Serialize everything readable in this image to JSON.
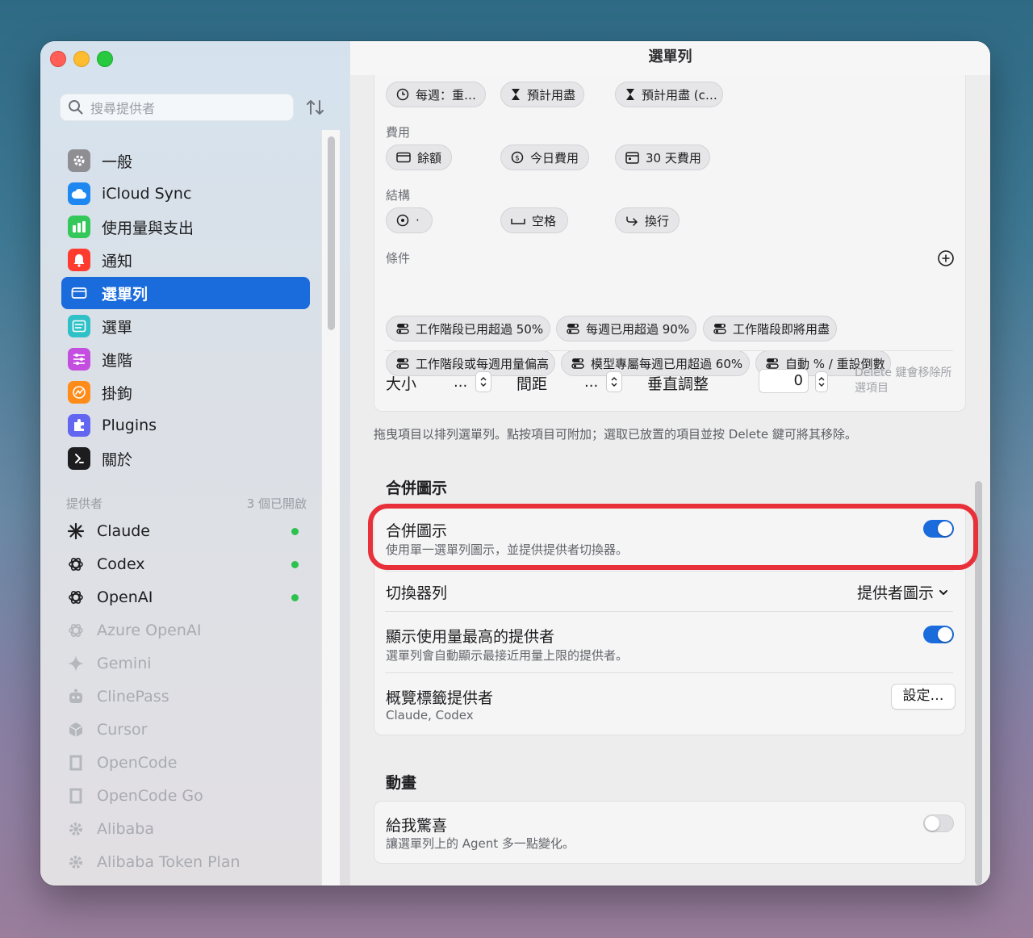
{
  "window": {
    "title": "選單列"
  },
  "sidebar": {
    "search_placeholder": "搜尋提供者",
    "items": [
      {
        "label": "一般",
        "icon": "gear-icon",
        "color": "#8e8e93"
      },
      {
        "label": "iCloud Sync",
        "icon": "cloud-icon",
        "color": "#1e88f0"
      },
      {
        "label": "使用量與支出",
        "icon": "bar-chart-icon",
        "color": "#34c759"
      },
      {
        "label": "通知",
        "icon": "bell-icon",
        "color": "#ff3b30"
      },
      {
        "label": "選單列",
        "icon": "menubar-icon",
        "color": "#1a6bdc"
      },
      {
        "label": "選單",
        "icon": "menu-icon",
        "color": "#30c0c8"
      },
      {
        "label": "進階",
        "icon": "sliders-icon",
        "color": "#c44ee0"
      },
      {
        "label": "掛鉤",
        "icon": "hook-icon",
        "color": "#ff8c1a"
      },
      {
        "label": "Plugins",
        "icon": "plugin-icon",
        "color": "#6366f1"
      },
      {
        "label": "關於",
        "icon": "terminal-icon",
        "color": "#1d1d1f"
      }
    ],
    "providers_header": "提供者",
    "providers_count": "3 個已開啟",
    "providers": [
      {
        "label": "Claude",
        "icon": "claude-icon",
        "enabled": true
      },
      {
        "label": "Codex",
        "icon": "openai-icon",
        "enabled": true
      },
      {
        "label": "OpenAI",
        "icon": "openai-icon",
        "enabled": true
      },
      {
        "label": "Azure OpenAI",
        "icon": "openai-icon",
        "enabled": false
      },
      {
        "label": "Gemini",
        "icon": "sparkle-icon",
        "enabled": false
      },
      {
        "label": "ClinePass",
        "icon": "robot-icon",
        "enabled": false
      },
      {
        "label": "Cursor",
        "icon": "cube-icon",
        "enabled": false
      },
      {
        "label": "OpenCode",
        "icon": "square-icon",
        "enabled": false
      },
      {
        "label": "OpenCode Go",
        "icon": "square-icon",
        "enabled": false
      },
      {
        "label": "Alibaba",
        "icon": "gear-icon",
        "enabled": false
      },
      {
        "label": "Alibaba Token Plan",
        "icon": "gear-icon",
        "enabled": false
      }
    ]
  },
  "main": {
    "top_chips": [
      "每週：重…",
      "預計用盡",
      "預計用盡 (c…"
    ],
    "cost_label": "費用",
    "cost_chips": [
      "餘額",
      "今日費用",
      "30 天費用"
    ],
    "structure_label": "結構",
    "structure_chips": [
      "·",
      "空格",
      "換行"
    ],
    "conditions_label": "條件",
    "condition_chips_row1": [
      "工作階段已用超過 50%",
      "每週已用超過 90%",
      "工作階段即將用盡"
    ],
    "condition_chips_row2": [
      "工作階段或每週用量偏高",
      "模型專屬每週已用超過 60%",
      "自動 % / 重設倒數"
    ],
    "size_label": "大小",
    "size_value": "...",
    "spacing_label": "間距",
    "spacing_value": "...",
    "vertical_label": "垂直調整",
    "vertical_value": "0",
    "delete_hint": "Delete 鍵會移除所選項目",
    "drag_hint": "拖曳項目以排列選單列。點按項目可附加；選取已放置的項目並按 Delete 鍵可將其移除。",
    "merge_section_title": "合併圖示",
    "merge_title": "合併圖示",
    "merge_sub": "使用單一選單列圖示，並提供提供者切換器。",
    "merge_on": true,
    "switcher_label": "切換器列",
    "switcher_value": "提供者圖示",
    "highest_title": "顯示使用量最高的提供者",
    "highest_sub": "選單列會自動顯示最接近用量上限的提供者。",
    "highest_on": true,
    "overview_title": "概覽標籤提供者",
    "overview_sub": "Claude, Codex",
    "overview_button": "設定…",
    "animation_section_title": "動畫",
    "surprise_title": "給我驚喜",
    "surprise_sub": "讓選單列上的 Agent 多一點變化。",
    "surprise_on": false,
    "highlight_color": "#e8303a"
  }
}
